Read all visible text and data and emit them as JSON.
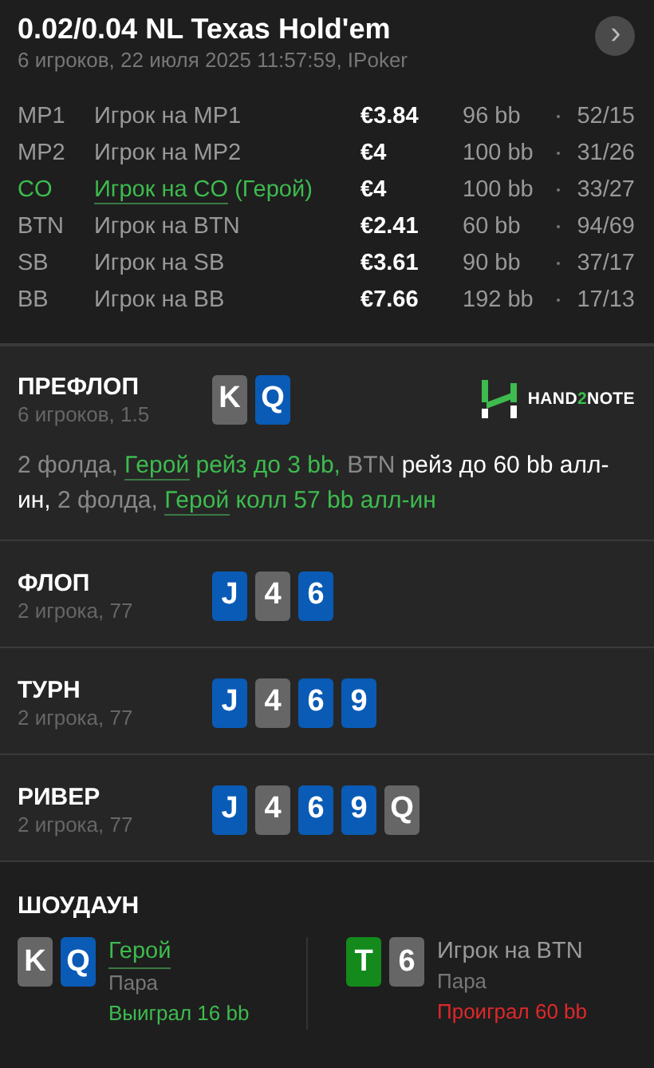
{
  "header": {
    "title": "0.02/0.04 NL Texas Hold'em",
    "subtitle": "6 игроков, 22 июля 2025 11:57:59, IPoker",
    "next_button": "›"
  },
  "players": [
    {
      "position": "MP1",
      "name": "Игрок на MP1",
      "hero": false,
      "stack": "€3.84",
      "bb": "96 bb",
      "stats": "52/15"
    },
    {
      "position": "MP2",
      "name": "Игрок на MP2",
      "hero": false,
      "stack": "€4",
      "bb": "100 bb",
      "stats": "31/26"
    },
    {
      "position": "CO",
      "name": "Игрок на CO",
      "hero": true,
      "hero_tag": "(Герой)",
      "stack": "€4",
      "bb": "100 bb",
      "stats": "33/27"
    },
    {
      "position": "BTN",
      "name": "Игрок на BTN",
      "hero": false,
      "stack": "€2.41",
      "bb": "60 bb",
      "stats": "94/69"
    },
    {
      "position": "SB",
      "name": "Игрок на SB",
      "hero": false,
      "stack": "€3.61",
      "bb": "90 bb",
      "stats": "37/17"
    },
    {
      "position": "BB",
      "name": "Игрок на BB",
      "hero": false,
      "stack": "€7.66",
      "bb": "192 bb",
      "stats": "17/13"
    }
  ],
  "preflop": {
    "title": "ПРЕФЛОП",
    "subtitle": "6 игроков, 1.5",
    "cards": [
      {
        "rank": "K",
        "color": "#666666"
      },
      {
        "rank": "Q",
        "color": "#0a5bb5"
      }
    ],
    "logo": {
      "before": "HAND",
      "accent": "2",
      "after": "NOTE"
    },
    "actions": [
      {
        "kind": "neutral",
        "text": "2 фолда, "
      },
      {
        "kind": "hero_name",
        "text": "Герой"
      },
      {
        "kind": "hero",
        "text": " рейз до 3 bb,"
      },
      {
        "kind": "neutral",
        "text": " BTN"
      },
      {
        "kind": "action",
        "text": " рейз до 60 bb алл-ин,"
      },
      {
        "kind": "neutral",
        "text": " 2 фолда, "
      },
      {
        "kind": "hero_name",
        "text": "Герой"
      },
      {
        "kind": "hero",
        "text": " колл 57 bb алл-ин"
      }
    ]
  },
  "streets": [
    {
      "title": "ФЛОП",
      "subtitle": "2 игрока, 77",
      "cards": [
        {
          "rank": "J",
          "color": "#0a5bb5"
        },
        {
          "rank": "4",
          "color": "#666666"
        },
        {
          "rank": "6",
          "color": "#0a5bb5"
        }
      ]
    },
    {
      "title": "ТУРН",
      "subtitle": "2 игрока, 77",
      "cards": [
        {
          "rank": "J",
          "color": "#0a5bb5"
        },
        {
          "rank": "4",
          "color": "#666666"
        },
        {
          "rank": "6",
          "color": "#0a5bb5"
        },
        {
          "rank": "9",
          "color": "#0a5bb5"
        }
      ]
    },
    {
      "title": "РИВЕР",
      "subtitle": "2 игрока, 77",
      "cards": [
        {
          "rank": "J",
          "color": "#0a5bb5"
        },
        {
          "rank": "4",
          "color": "#666666"
        },
        {
          "rank": "6",
          "color": "#0a5bb5"
        },
        {
          "rank": "9",
          "color": "#0a5bb5"
        },
        {
          "rank": "Q",
          "color": "#666666"
        }
      ]
    }
  ],
  "showdown": {
    "title": "ШОУДАУН",
    "hands": [
      {
        "cards": [
          {
            "rank": "K",
            "color": "#666666"
          },
          {
            "rank": "Q",
            "color": "#0a5bb5"
          }
        ],
        "name": "Герой",
        "hero": true,
        "combo": "Пара",
        "result": "Выиграл 16 bb",
        "won": true
      },
      {
        "cards": [
          {
            "rank": "T",
            "color": "#138a1b"
          },
          {
            "rank": "6",
            "color": "#666666"
          }
        ],
        "name": "Игрок на BTN",
        "hero": false,
        "combo": "Пара",
        "result": "Проиграл 60 bb",
        "won": false
      }
    ]
  }
}
